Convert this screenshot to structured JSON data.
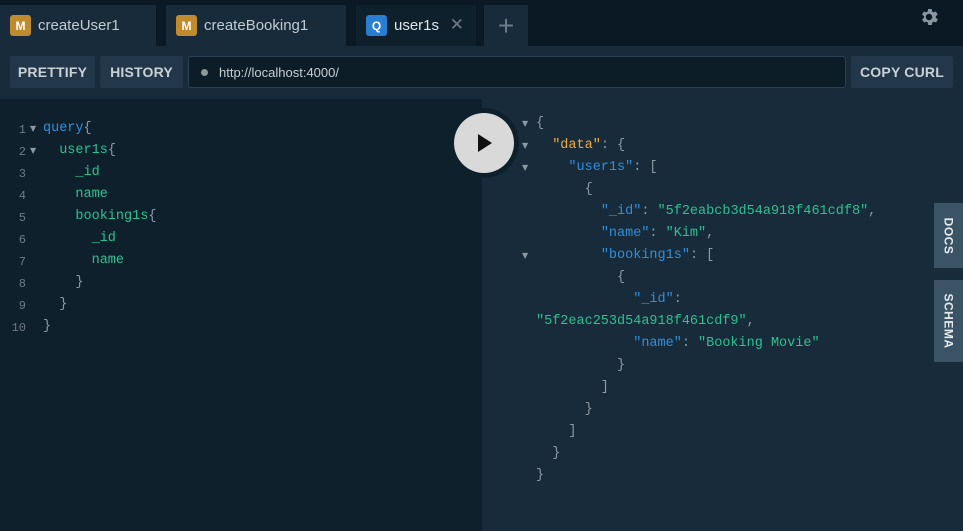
{
  "tabs": [
    {
      "badge": "M",
      "label": "createUser1"
    },
    {
      "badge": "M",
      "label": "createBooking1"
    },
    {
      "badge": "Q",
      "label": "user1s",
      "close": "✕"
    }
  ],
  "tab_add_label": "+",
  "toolbar": {
    "prettify": "PRETTIFY",
    "history": "HISTORY",
    "url": "http://localhost:4000/",
    "copy_curl": "COPY CURL"
  },
  "editor": {
    "line_numbers": [
      "1",
      "2",
      "3",
      "4",
      "5",
      "6",
      "7",
      "8",
      "9",
      "10"
    ],
    "lines": [
      {
        "tokens": [
          {
            "t": "query",
            "c": "kw"
          },
          {
            "t": "{",
            "c": "punc"
          }
        ]
      },
      {
        "tokens": [
          {
            "t": "  user1s",
            "c": "fld"
          },
          {
            "t": "{",
            "c": "punc"
          }
        ]
      },
      {
        "tokens": [
          {
            "t": "    _id",
            "c": "fld"
          }
        ]
      },
      {
        "tokens": [
          {
            "t": "    name",
            "c": "fld"
          }
        ]
      },
      {
        "tokens": [
          {
            "t": "    booking1s",
            "c": "fld"
          },
          {
            "t": "{",
            "c": "punc"
          }
        ]
      },
      {
        "tokens": [
          {
            "t": "      _id",
            "c": "fld"
          }
        ]
      },
      {
        "tokens": [
          {
            "t": "      name",
            "c": "fld"
          }
        ]
      },
      {
        "tokens": [
          {
            "t": "    }",
            "c": "punc"
          }
        ]
      },
      {
        "tokens": [
          {
            "t": "  }",
            "c": "punc"
          }
        ]
      },
      {
        "tokens": [
          {
            "t": "}",
            "c": "punc"
          }
        ]
      }
    ]
  },
  "result": {
    "lines": [
      {
        "tokens": [
          {
            "t": "{",
            "c": "punc"
          }
        ]
      },
      {
        "tokens": [
          {
            "t": "  ",
            "c": "punc"
          },
          {
            "t": "\"data\"",
            "c": "jdata"
          },
          {
            "t": ": {",
            "c": "punc"
          }
        ]
      },
      {
        "tokens": [
          {
            "t": "    ",
            "c": "punc"
          },
          {
            "t": "\"user1s\"",
            "c": "jkey"
          },
          {
            "t": ": [",
            "c": "punc"
          }
        ]
      },
      {
        "tokens": [
          {
            "t": "      {",
            "c": "punc"
          }
        ]
      },
      {
        "tokens": [
          {
            "t": "        ",
            "c": "punc"
          },
          {
            "t": "\"_id\"",
            "c": "jkey"
          },
          {
            "t": ": ",
            "c": "punc"
          },
          {
            "t": "\"5f2eabcb3d54a918f461cdf8\"",
            "c": "jstr"
          },
          {
            "t": ",",
            "c": "punc"
          }
        ]
      },
      {
        "tokens": [
          {
            "t": "        ",
            "c": "punc"
          },
          {
            "t": "\"name\"",
            "c": "jkey"
          },
          {
            "t": ": ",
            "c": "punc"
          },
          {
            "t": "\"Kim\"",
            "c": "jstr"
          },
          {
            "t": ",",
            "c": "punc"
          }
        ]
      },
      {
        "tokens": [
          {
            "t": "        ",
            "c": "punc"
          },
          {
            "t": "\"booking1s\"",
            "c": "jkey"
          },
          {
            "t": ": [",
            "c": "punc"
          }
        ]
      },
      {
        "tokens": [
          {
            "t": "          {",
            "c": "punc"
          }
        ]
      },
      {
        "tokens": [
          {
            "t": "            ",
            "c": "punc"
          },
          {
            "t": "\"_id\"",
            "c": "jkey"
          },
          {
            "t": ":",
            "c": "punc"
          }
        ]
      },
      {
        "tokens": [
          {
            "t": "\"5f2eac253d54a918f461cdf9\"",
            "c": "jstr"
          },
          {
            "t": ",",
            "c": "punc"
          }
        ]
      },
      {
        "tokens": [
          {
            "t": "            ",
            "c": "punc"
          },
          {
            "t": "\"name\"",
            "c": "jkey"
          },
          {
            "t": ": ",
            "c": "punc"
          },
          {
            "t": "\"Booking Movie\"",
            "c": "jstr"
          }
        ]
      },
      {
        "tokens": [
          {
            "t": "          }",
            "c": "punc"
          }
        ]
      },
      {
        "tokens": [
          {
            "t": "        ]",
            "c": "punc"
          }
        ]
      },
      {
        "tokens": [
          {
            "t": "      }",
            "c": "punc"
          }
        ]
      },
      {
        "tokens": [
          {
            "t": "    ]",
            "c": "punc"
          }
        ]
      },
      {
        "tokens": [
          {
            "t": "  }",
            "c": "punc"
          }
        ]
      },
      {
        "tokens": [
          {
            "t": "}",
            "c": "punc"
          }
        ]
      }
    ]
  },
  "side_tabs": {
    "docs": "DOCS",
    "schema": "SCHEMA"
  },
  "icons": {
    "settings": "gear-icon",
    "run": "play-icon",
    "fold": "caret-down-icon"
  }
}
